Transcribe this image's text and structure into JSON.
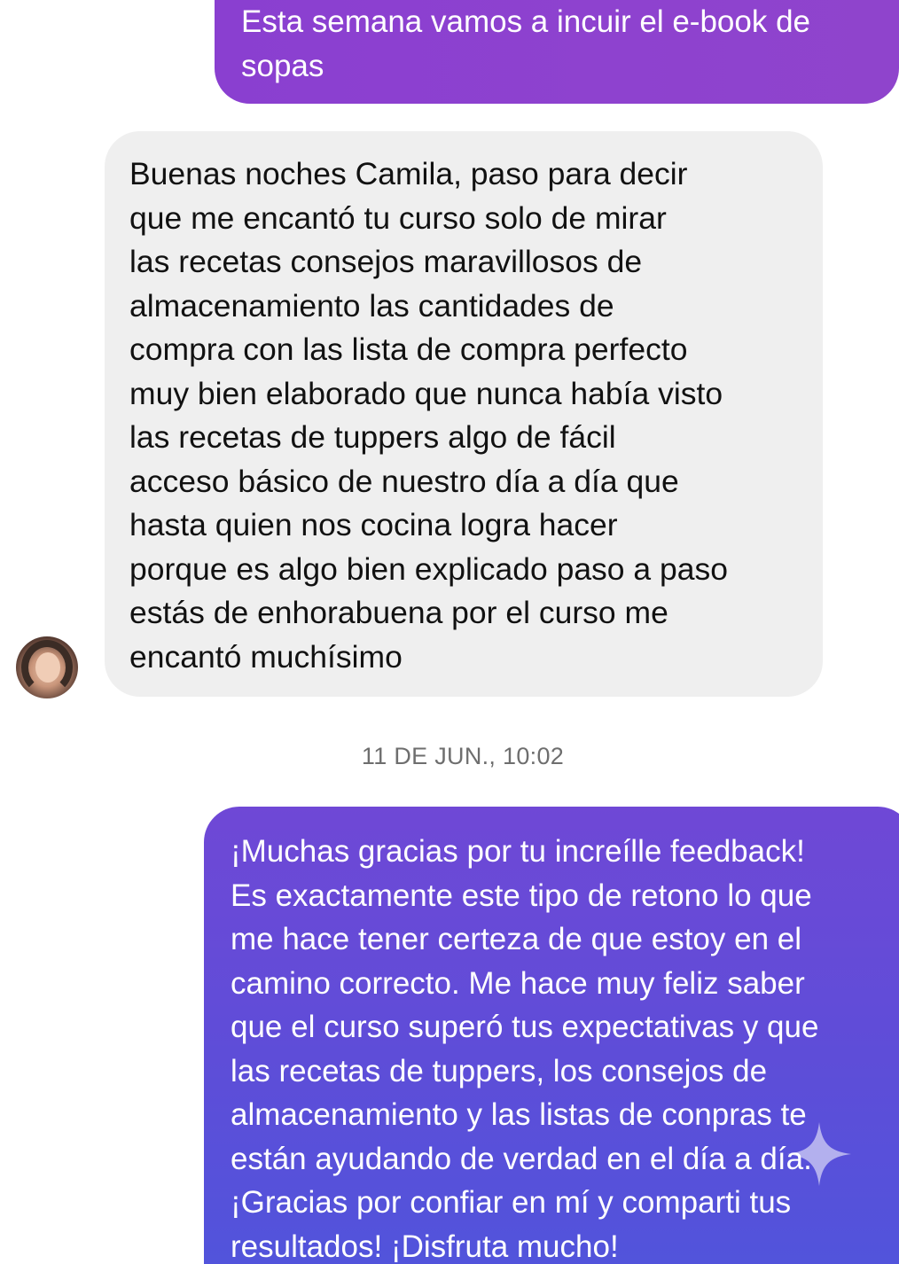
{
  "messages": {
    "outgoing_top": "Esta semana vamos a incuir el e-book de\nsopas",
    "incoming": "Buenas noches Camila, paso para decir\nque me encantó tu curso solo de mirar\nlas recetas consejos maravillosos de\nalmacenamiento las cantidades de\ncompra con las lista de compra perfecto\nmuy bien elaborado que nunca había visto\nlas recetas de tuppers algo de fácil\nacceso básico de nuestro día a día que\nhasta quien nos cocina logra hacer\nporque es algo bien explicado paso a paso\nestás de enhorabuena por el curso me\nencantó muchísimo",
    "outgoing_bottom": "¡Muchas gracias por tu increílle feedback!\nEs exactamente este tipo de retono lo que\nme hace tener certeza de que estoy en el\ncamino correcto. Me hace muy feliz saber\nque el curso superó tus expectativas y que\nlas recetas de tuppers, los consejos de\nalmacenamiento y las listas de conpras te\nestán ayudando de verdad en el día a día.\n¡Gracias por confiar en mí y comparti tus\nresultados! ¡Disfruta mucho!"
  },
  "timestamp": "11 DE JUN., 10:02",
  "icons": {
    "avatar": "contact-avatar",
    "watermark": "sparkle-icon"
  },
  "colors": {
    "outgoing_top": "#8d42cf",
    "outgoing_bottom": "#5e4dd8",
    "incoming": "#efefef",
    "timestamp": "#6e6e6e"
  }
}
